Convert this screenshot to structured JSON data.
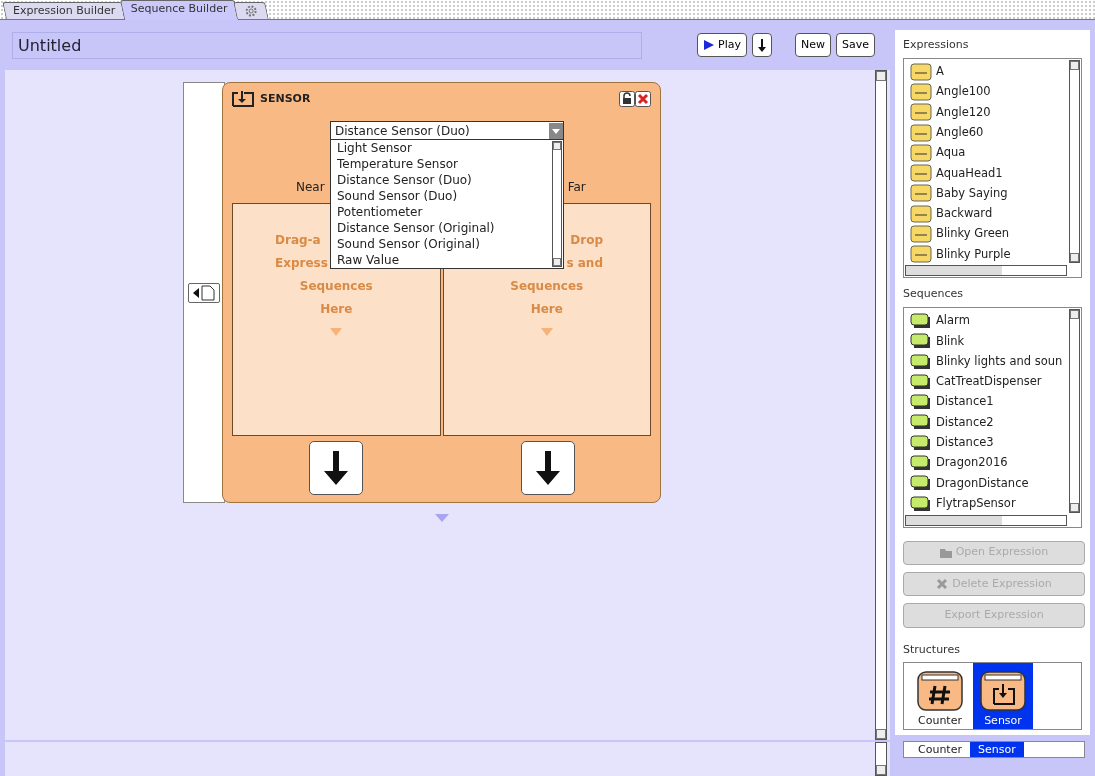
{
  "tabs": [
    {
      "kind": "text",
      "label": "Expression Builder",
      "selected": false
    },
    {
      "kind": "text",
      "label": "Sequence Builder",
      "selected": true
    },
    {
      "kind": "gear",
      "selected": false
    }
  ],
  "title_field": {
    "value": "Untitled"
  },
  "toolbar": [
    {
      "kind": "play",
      "label": "Play"
    },
    {
      "kind": "download"
    },
    {
      "kind": "text",
      "label": "New"
    },
    {
      "kind": "text",
      "label": "Save"
    }
  ],
  "sensor_block": {
    "title": "SENSOR",
    "near_label": "Near",
    "far_label": "Far",
    "dropdown": {
      "value": "Distance Sensor (Duo)",
      "expanded": true,
      "options": [
        "Light Sensor",
        "Temperature Sensor",
        "Distance Sensor (Duo)",
        "Sound Sensor (Duo)",
        "Potentiometer",
        "Distance Sensor (Original)",
        "Sound Sensor (Original)",
        "Raw Value"
      ]
    },
    "zones": [
      {
        "lines": [
          {
            "text": "Drag-a",
            "cut": true
          },
          {
            "text": "Express",
            "cut": true
          },
          {
            "text": "Sequences",
            "cut": false
          },
          {
            "text": "Here",
            "cut": false
          }
        ]
      },
      {
        "lines": [
          {
            "text": "Drop",
            "cut": true
          },
          {
            "text": "s and",
            "cut": true
          },
          {
            "text": "Sequences",
            "cut": false
          },
          {
            "text": "Here",
            "cut": false
          }
        ]
      }
    ]
  },
  "expressions": {
    "title": "Expressions",
    "items": [
      "A",
      "Angle100",
      "Angle120",
      "Angle60",
      "Aqua",
      "AquaHead1",
      "Baby Saying",
      "Backward",
      "Blinky Green",
      "Blinky Purple"
    ]
  },
  "sequences": {
    "title": "Sequences",
    "items": [
      "Alarm",
      "Blink",
      "Blinky lights and soun",
      "CatTreatDispenser",
      "Distance1",
      "Distance2",
      "Distance3",
      "Dragon2016",
      "DragonDistance",
      "FlytrapSensor"
    ]
  },
  "actions": [
    {
      "kind": "folder",
      "label": "Open Expression",
      "disabled": true
    },
    {
      "kind": "delete",
      "label": "Delete Expression",
      "disabled": true
    },
    {
      "kind": "text",
      "label": "Export Expression",
      "disabled": true
    }
  ],
  "structures": {
    "title": "Structures",
    "items": [
      {
        "kind": "counter",
        "label": "Counter",
        "selected": false
      },
      {
        "kind": "sensor",
        "label": "Sensor",
        "selected": true
      }
    ]
  },
  "bottom_structures": [
    {
      "label": "Counter",
      "selected": false
    },
    {
      "label": "Sensor",
      "selected": true
    }
  ]
}
